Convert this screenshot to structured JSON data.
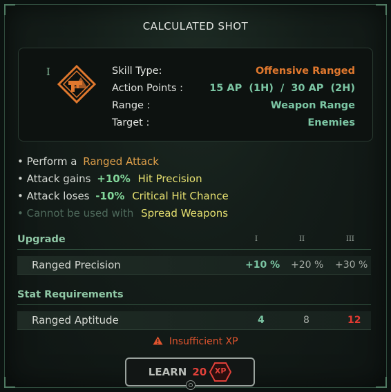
{
  "title": "CALCULATED SHOT",
  "rank_mark": "I",
  "skill_icon": "ranged-skill-icon",
  "info": [
    {
      "label": "Skill Type:",
      "value": "Offensive Ranged",
      "color": "#e0782e"
    },
    {
      "label": "Action Points :",
      "value": "15 AP  (1H)  /  30 AP  (2H)",
      "color": "#7cc6a4"
    },
    {
      "label": "Range :",
      "value": "Weapon Range",
      "color": "#7cc6a4"
    },
    {
      "label": "Target :",
      "value": "Enemies",
      "color": "#7cc6a4"
    }
  ],
  "effects": [
    {
      "bullet": "•",
      "pre": "Perform a",
      "mid": "",
      "post": "Ranged Attack"
    },
    {
      "bullet": "•",
      "pre": "Attack gains",
      "mid": "+10%",
      "post": "Hit Precision"
    },
    {
      "bullet": "•",
      "pre": "Attack loses",
      "mid": "-10%",
      "post": "Critical Hit Chance"
    },
    {
      "bullet": "•",
      "pre": "Cannot be used with",
      "mid": "",
      "post": "Spread Weapons"
    }
  ],
  "upgrade": {
    "heading": "Upgrade",
    "tiers": [
      "I",
      "II",
      "III"
    ],
    "row": {
      "name": "Ranged Precision",
      "values": [
        "+10 %",
        "+20 %",
        "+30 %"
      ]
    }
  },
  "requirements": {
    "heading": "Stat Requirements",
    "row": {
      "name": "Ranged Aptitude",
      "values": [
        "4",
        "8",
        "12"
      ]
    }
  },
  "warning": {
    "icon": "warning-icon",
    "text": "Insufficient XP"
  },
  "learn_button": {
    "label": "LEARN",
    "cost": "20",
    "currency": "XP"
  },
  "colors": {
    "accent_green": "#7cc6a4",
    "accent_orange": "#e0782e",
    "error_red": "#e2413a"
  }
}
